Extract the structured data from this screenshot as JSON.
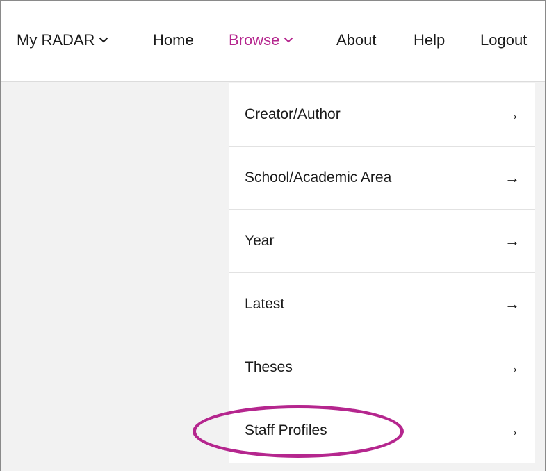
{
  "nav": {
    "items": [
      {
        "label": "My RADAR",
        "has_dropdown": true,
        "active": false
      },
      {
        "label": "Home",
        "has_dropdown": false,
        "active": false
      },
      {
        "label": "Browse",
        "has_dropdown": true,
        "active": true
      },
      {
        "label": "About",
        "has_dropdown": false,
        "active": false
      },
      {
        "label": "Help",
        "has_dropdown": false,
        "active": false
      },
      {
        "label": "Logout",
        "has_dropdown": false,
        "active": false
      }
    ]
  },
  "browse_menu": {
    "items": [
      {
        "label": "Creator/Author",
        "arrow": "→"
      },
      {
        "label": "School/Academic Area",
        "arrow": "→"
      },
      {
        "label": "Year",
        "arrow": "→"
      },
      {
        "label": "Latest",
        "arrow": "→"
      },
      {
        "label": "Theses",
        "arrow": "→"
      },
      {
        "label": "Staff Profiles",
        "arrow": "→"
      }
    ],
    "highlighted_item": "Staff Profiles"
  },
  "colors": {
    "accent": "#b5268e",
    "text": "#1a1a1a",
    "background_muted": "#f2f2f2",
    "divider": "#e2e2e2"
  },
  "icons": {
    "dropdown_indicator": "chevron-down-icon",
    "menu_item_indicator": "arrow-right-icon"
  }
}
